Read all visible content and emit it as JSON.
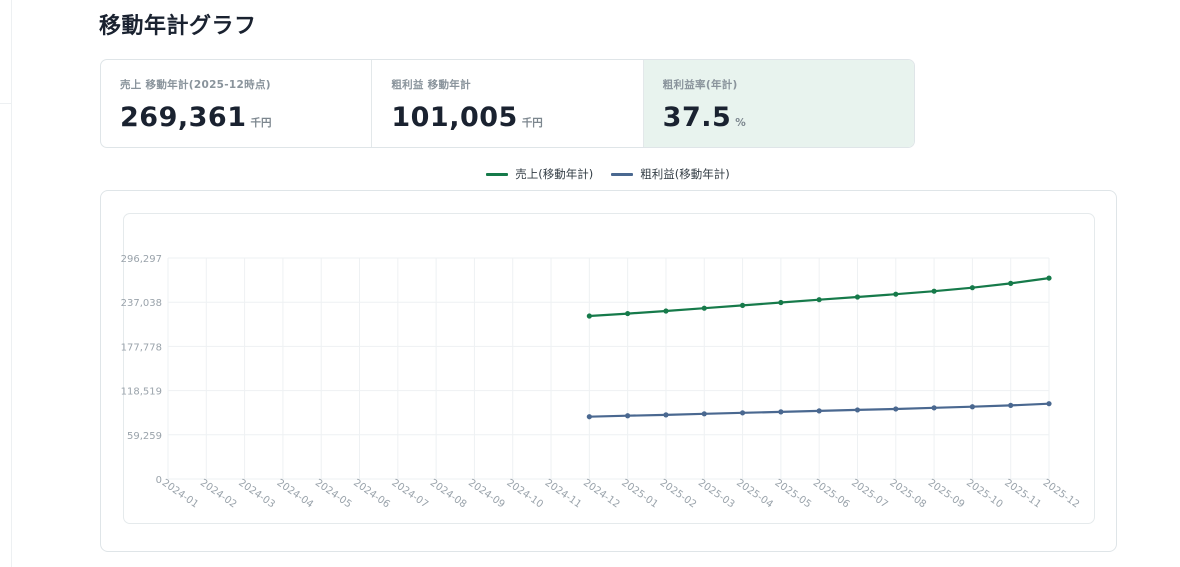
{
  "page": {
    "title": "移動年計グラフ"
  },
  "kpis": [
    {
      "label": "売上 移動年計(2025-12時点)",
      "value": "269,361",
      "unit": "千円"
    },
    {
      "label": "粗利益 移動年計",
      "value": "101,005",
      "unit": "千円"
    },
    {
      "label": "粗利益率(年計)",
      "value": "37.5",
      "unit": "%"
    }
  ],
  "colors": {
    "sales": "#167a4a",
    "gross_profit": "#4a6890",
    "highlight_bg": "#e8f3ee",
    "grid": "#eef1f3",
    "tick_text": "#9aa3ab"
  },
  "chart_data": {
    "type": "line",
    "x": [
      "2024-01",
      "2024-02",
      "2024-03",
      "2024-04",
      "2024-05",
      "2024-06",
      "2024-07",
      "2024-08",
      "2024-09",
      "2024-10",
      "2024-11",
      "2024-12",
      "2025-01",
      "2025-02",
      "2025-03",
      "2025-04",
      "2025-05",
      "2025-06",
      "2025-07",
      "2025-08",
      "2025-09",
      "2025-10",
      "2025-11",
      "2025-12"
    ],
    "series": [
      {
        "name": "売上(移動年計)",
        "color": "#167a4a",
        "values": [
          null,
          null,
          null,
          null,
          null,
          null,
          null,
          null,
          null,
          null,
          null,
          218500,
          221800,
          225200,
          229000,
          232800,
          236600,
          240400,
          244000,
          247800,
          251800,
          256500,
          262300,
          269361
        ]
      },
      {
        "name": "粗利益(移動年計)",
        "color": "#4a6890",
        "values": [
          null,
          null,
          null,
          null,
          null,
          null,
          null,
          null,
          null,
          null,
          null,
          83500,
          84800,
          86000,
          87400,
          88700,
          90000,
          91300,
          92600,
          93900,
          95400,
          96900,
          98700,
          101005
        ]
      }
    ],
    "y_ticks": [
      "0",
      "59,259",
      "118,519",
      "177,778",
      "237,038",
      "296,297"
    ],
    "ylim": [
      0,
      296297
    ],
    "grid": true,
    "legend_position": "top-center"
  }
}
